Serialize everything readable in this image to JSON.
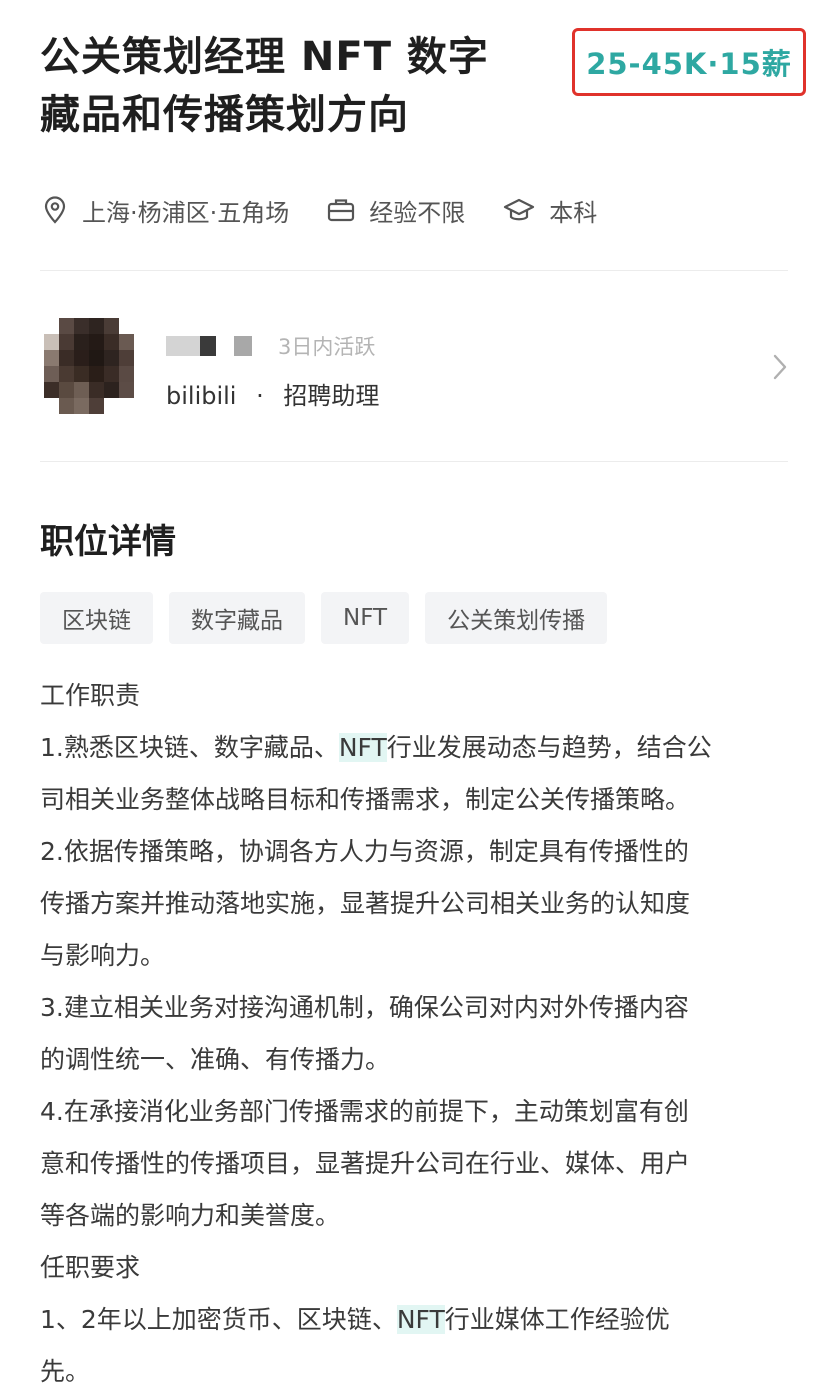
{
  "job": {
    "title_line1": "公关策划经理 NFT 数字",
    "title_line2": "藏品和传播策划方向",
    "salary": "25-45K·15薪",
    "location": "上海·杨浦区·五角场",
    "experience": "经验不限",
    "education": "本科",
    "icons": [
      "location-pin-icon",
      "briefcase-icon",
      "graduation-cap-icon"
    ]
  },
  "recruiter": {
    "active_status": "3日内活跃",
    "company": "bilibili",
    "separator": "·",
    "role": "招聘助理"
  },
  "details": {
    "section_title": "职位详情",
    "tags": [
      "区块链",
      "数字藏品",
      "NFT",
      "公关策划传播"
    ],
    "lines": [
      [
        "工作职责"
      ],
      [
        "1.熟悉区块链、数字藏品、",
        "NFT",
        "行业发展动态与趋势，结合公"
      ],
      [
        "司相关业务整体战略目标和传播需求，制定公关传播策略。"
      ],
      [
        "2.依据传播策略，协调各方人力与资源，制定具有传播性的"
      ],
      [
        "传播方案并推动落地实施，显著提升公司相关业务的认知度"
      ],
      [
        "与影响力。"
      ],
      [
        "3.建立相关业务对接沟通机制，确保公司对内对外传播内容"
      ],
      [
        "的调性统一、准确、有传播力。"
      ],
      [
        "4.在承接消化业务部门传播需求的前提下，主动策划富有创"
      ],
      [
        "意和传播性的传播项目，显著提升公司在行业、媒体、用户"
      ],
      [
        "等各端的影响力和美誉度。"
      ],
      [
        "任职要求"
      ],
      [
        "1、2年以上加密货币、区块链、",
        "NFT",
        "行业媒体工作经验优"
      ],
      [
        "先。"
      ]
    ]
  },
  "colors": {
    "salary": "#2ea8a2",
    "highlight_box": "#e0322b",
    "keyword_highlight": "#e2f6f3"
  }
}
